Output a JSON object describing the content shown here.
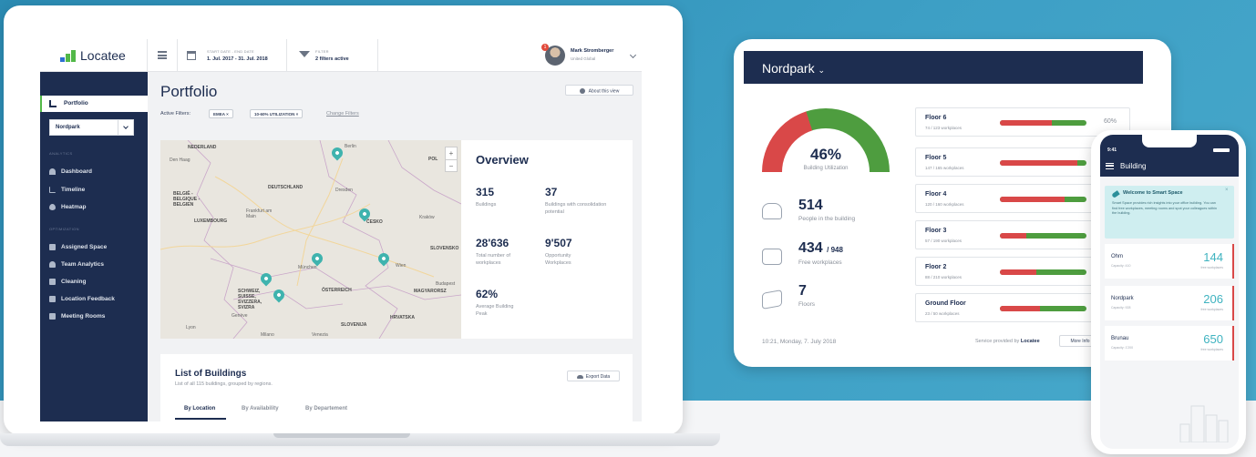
{
  "laptop": {
    "app_name": "Locatee",
    "topbar": {
      "date_label": "START DATE - END DATE",
      "date_value": "1. Jul. 2017 - 31. Jul. 2018",
      "filter_label": "FILTER",
      "filter_value": "2 filters active",
      "user_name": "Mark Stromberger",
      "user_org": "United Global",
      "notification_count": "1"
    },
    "sidebar": {
      "portfolio_label": "Portfolio",
      "building_select": "Nordpark",
      "section_analytics": "ANALYTICS",
      "analytics_items": [
        "Dashboard",
        "Timeline",
        "Heatmap"
      ],
      "section_optimization": "OPTIMIZATION",
      "optimization_items": [
        "Assigned Space",
        "Team Analytics",
        "Cleaning",
        "Location Feedback",
        "Meeting Rooms"
      ]
    },
    "page": {
      "title": "Portfolio",
      "about_button": "About this view",
      "active_filters_label": "Active Filters:",
      "filter_chips": [
        "EMEA ×",
        "10-60% UTILIZATION ×"
      ],
      "change_filters": "Change Filters"
    },
    "map": {
      "labels": [
        "NEDERLAND",
        "Den Haag",
        "Berlin",
        "POL",
        "DEUTSCHLAND",
        "Dresden",
        "BELGIË - BELGIQUE - BELGIEN",
        "Frankfurt am Main",
        "LUXEMBOURG",
        "ČESKO",
        "Kraków",
        "SLOVENSKO",
        "München",
        "Wien",
        "ÖSTERREICH",
        "Budapest",
        "MAGYARORSZ",
        "SCHWEIZ, SUISSE, SVIZZERA, SVIZRA",
        "Genève",
        "Lyon",
        "Milano",
        "Venezia",
        "SLOVENIJA",
        "HRVATSKA"
      ],
      "zoom_in": "+",
      "zoom_out": "−"
    },
    "overview": {
      "title": "Overview",
      "stats": [
        {
          "value": "315",
          "label": "Buildings"
        },
        {
          "value": "37",
          "label": "Buildings with consolidation potential"
        },
        {
          "value": "28'636",
          "label": "Total number of workplaces"
        },
        {
          "value": "9'507",
          "label": "Opportunity Workplaces"
        },
        {
          "value": "62%",
          "label": "Average Building Peak"
        }
      ]
    },
    "list": {
      "title": "List of Buildings",
      "subtitle": "List of all 115 buildings, grouped by regions.",
      "export_button": "Export Data",
      "tabs": [
        "By Location",
        "By Availability",
        "By Departement"
      ]
    }
  },
  "tablet": {
    "building": "Nordpark",
    "utilization_value": 46,
    "utilization_pct": "46%",
    "utilization_label": "Building Utilization",
    "people_value": "514",
    "people_label": "People in the building",
    "free_value": "434",
    "free_total": "/ 948",
    "free_label": "Free workplaces",
    "floors_value": "7",
    "floors_label": "Floors",
    "floors": [
      {
        "name": "Floor 6",
        "sub": "74 / 123 workplaces",
        "pct_label": "60%",
        "util": 0.6
      },
      {
        "name": "Floor 5",
        "sub": "147 / 165 workplaces",
        "pct_label": "",
        "util": 0.89
      },
      {
        "name": "Floor 4",
        "sub": "120 / 160 workplaces",
        "pct_label": "",
        "util": 0.75
      },
      {
        "name": "Floor 3",
        "sub": "57 / 190 workplaces",
        "pct_label": "",
        "util": 0.3
      },
      {
        "name": "Floor 2",
        "sub": "88 / 210 workplaces",
        "pct_label": "",
        "util": 0.42
      },
      {
        "name": "Ground Floor",
        "sub": "23 / 50 workplaces",
        "pct_label": "",
        "util": 0.46
      }
    ],
    "footer_time": "10:21, Monday, 7. July 2018",
    "footer_service": "Service provided by",
    "footer_brand": "Locatee",
    "more_info": "More Info"
  },
  "phone": {
    "time": "9:41",
    "title": "Building",
    "welcome_title": "Welcome to Smart Space",
    "welcome_text": "Smart Space provides rich insights into your office building. You can find free workplaces, meeting rooms and spot your colleagues within the building.",
    "close": "×",
    "cards": [
      {
        "name": "Ohm",
        "capacity": "Capacity: 410",
        "value": "144",
        "label": "free workplaces"
      },
      {
        "name": "Nordpark",
        "capacity": "Capacity: 928",
        "value": "206",
        "label": "free workplaces"
      },
      {
        "name": "Brunau",
        "capacity": "Capacity: 1'200",
        "value": "650",
        "label": "free workplaces"
      }
    ]
  },
  "colors": {
    "navy": "#1d2d50",
    "green": "#4e9d3f",
    "red": "#d94848",
    "teal": "#3fb3ae",
    "background": "#3d9fc5"
  }
}
